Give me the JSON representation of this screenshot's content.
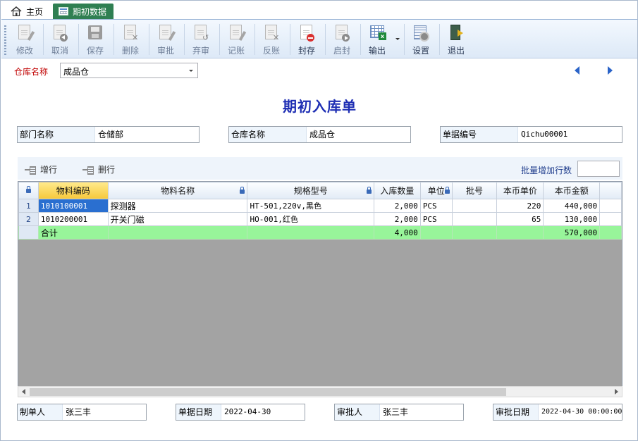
{
  "tabs": {
    "home_label": "主页",
    "active_label": "期初数据"
  },
  "toolbar": {
    "buttons": [
      {
        "label": "修改"
      },
      {
        "label": "取消"
      },
      {
        "label": "保存"
      },
      {
        "label": "删除"
      },
      {
        "label": "审批"
      },
      {
        "label": "弃审"
      },
      {
        "label": "记账"
      },
      {
        "label": "反账"
      },
      {
        "label": "封存"
      },
      {
        "label": "启封"
      },
      {
        "label": "输出"
      },
      {
        "label": "设置"
      },
      {
        "label": "退出"
      }
    ]
  },
  "warehouse": {
    "label": "仓库名称",
    "value": "成品仓"
  },
  "document": {
    "title": "期初入库单",
    "dept_label": "部门名称",
    "dept_value": "仓储部",
    "wh_label": "仓库名称",
    "wh_value": "成品仓",
    "no_label": "单据编号",
    "no_value": "Qichu00001"
  },
  "grid_toolbar": {
    "add_row": "增行",
    "del_row": "删行",
    "batch_label": "批量增加行数",
    "batch_value": ""
  },
  "grid": {
    "columns": [
      "物料编码",
      "物料名称",
      "规格型号",
      "入库数量",
      "单位",
      "批号",
      "本币单价",
      "本币金额"
    ],
    "rows": [
      {
        "n": "1",
        "code": "1010100001",
        "name": "探测器",
        "spec": "HT-501,220v,黑色",
        "qty": "2,000",
        "unit": "PCS",
        "batch": "",
        "price": "220",
        "amount": "440,000"
      },
      {
        "n": "2",
        "code": "1010200001",
        "name": "开关门磁",
        "spec": "HO-001,红色",
        "qty": "2,000",
        "unit": "PCS",
        "batch": "",
        "price": "65",
        "amount": "130,000"
      }
    ],
    "total": {
      "label": "合计",
      "qty": "4,000",
      "amount": "570,000"
    }
  },
  "footer": {
    "maker_label": "制单人",
    "maker_value": "张三丰",
    "date_label": "单据日期",
    "date_value": "2022-04-30",
    "approver_label": "审批人",
    "approver_value": "张三丰",
    "approve_date_label": "审批日期",
    "approve_date_value": "2022-04-30 00:00:00"
  },
  "colors": {
    "accent_tab": "#2f7f52",
    "title_blue": "#1f2fb4",
    "label_red": "#c00000",
    "total_green": "#98f59a",
    "selection_blue": "#2a6fd0"
  }
}
